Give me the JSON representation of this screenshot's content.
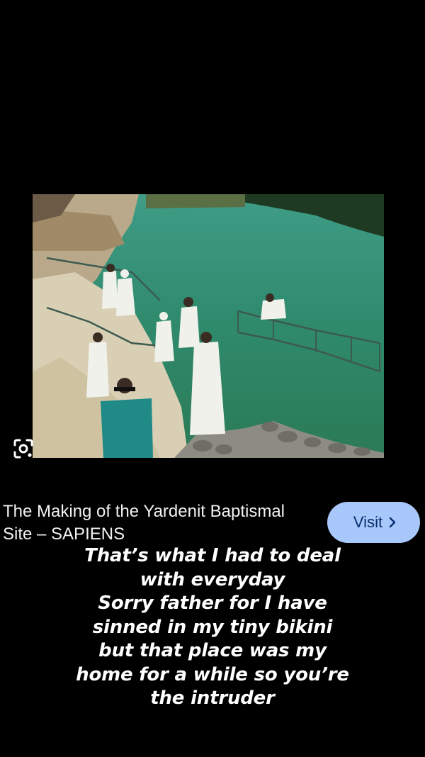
{
  "image": {
    "description_label": "baptism-site-photo"
  },
  "lens": {
    "icon": "lens-search-icon"
  },
  "result": {
    "title": "The Making of the Yardenit Baptismal Site – SAPIENS",
    "visit_label": "Visit",
    "visit_icon": "chevron-right-icon"
  },
  "caption": {
    "lines": [
      "That’s what I had to deal",
      "with everyday",
      "Sorry father for I have",
      "sinned in my tiny bikini",
      "but that place was my",
      "home for a while so you’re",
      "the intruder"
    ]
  },
  "colors": {
    "background": "#000000",
    "visit_button": "#a8c7fa",
    "visit_text": "#062e6f",
    "water": "#2f8a6c"
  }
}
